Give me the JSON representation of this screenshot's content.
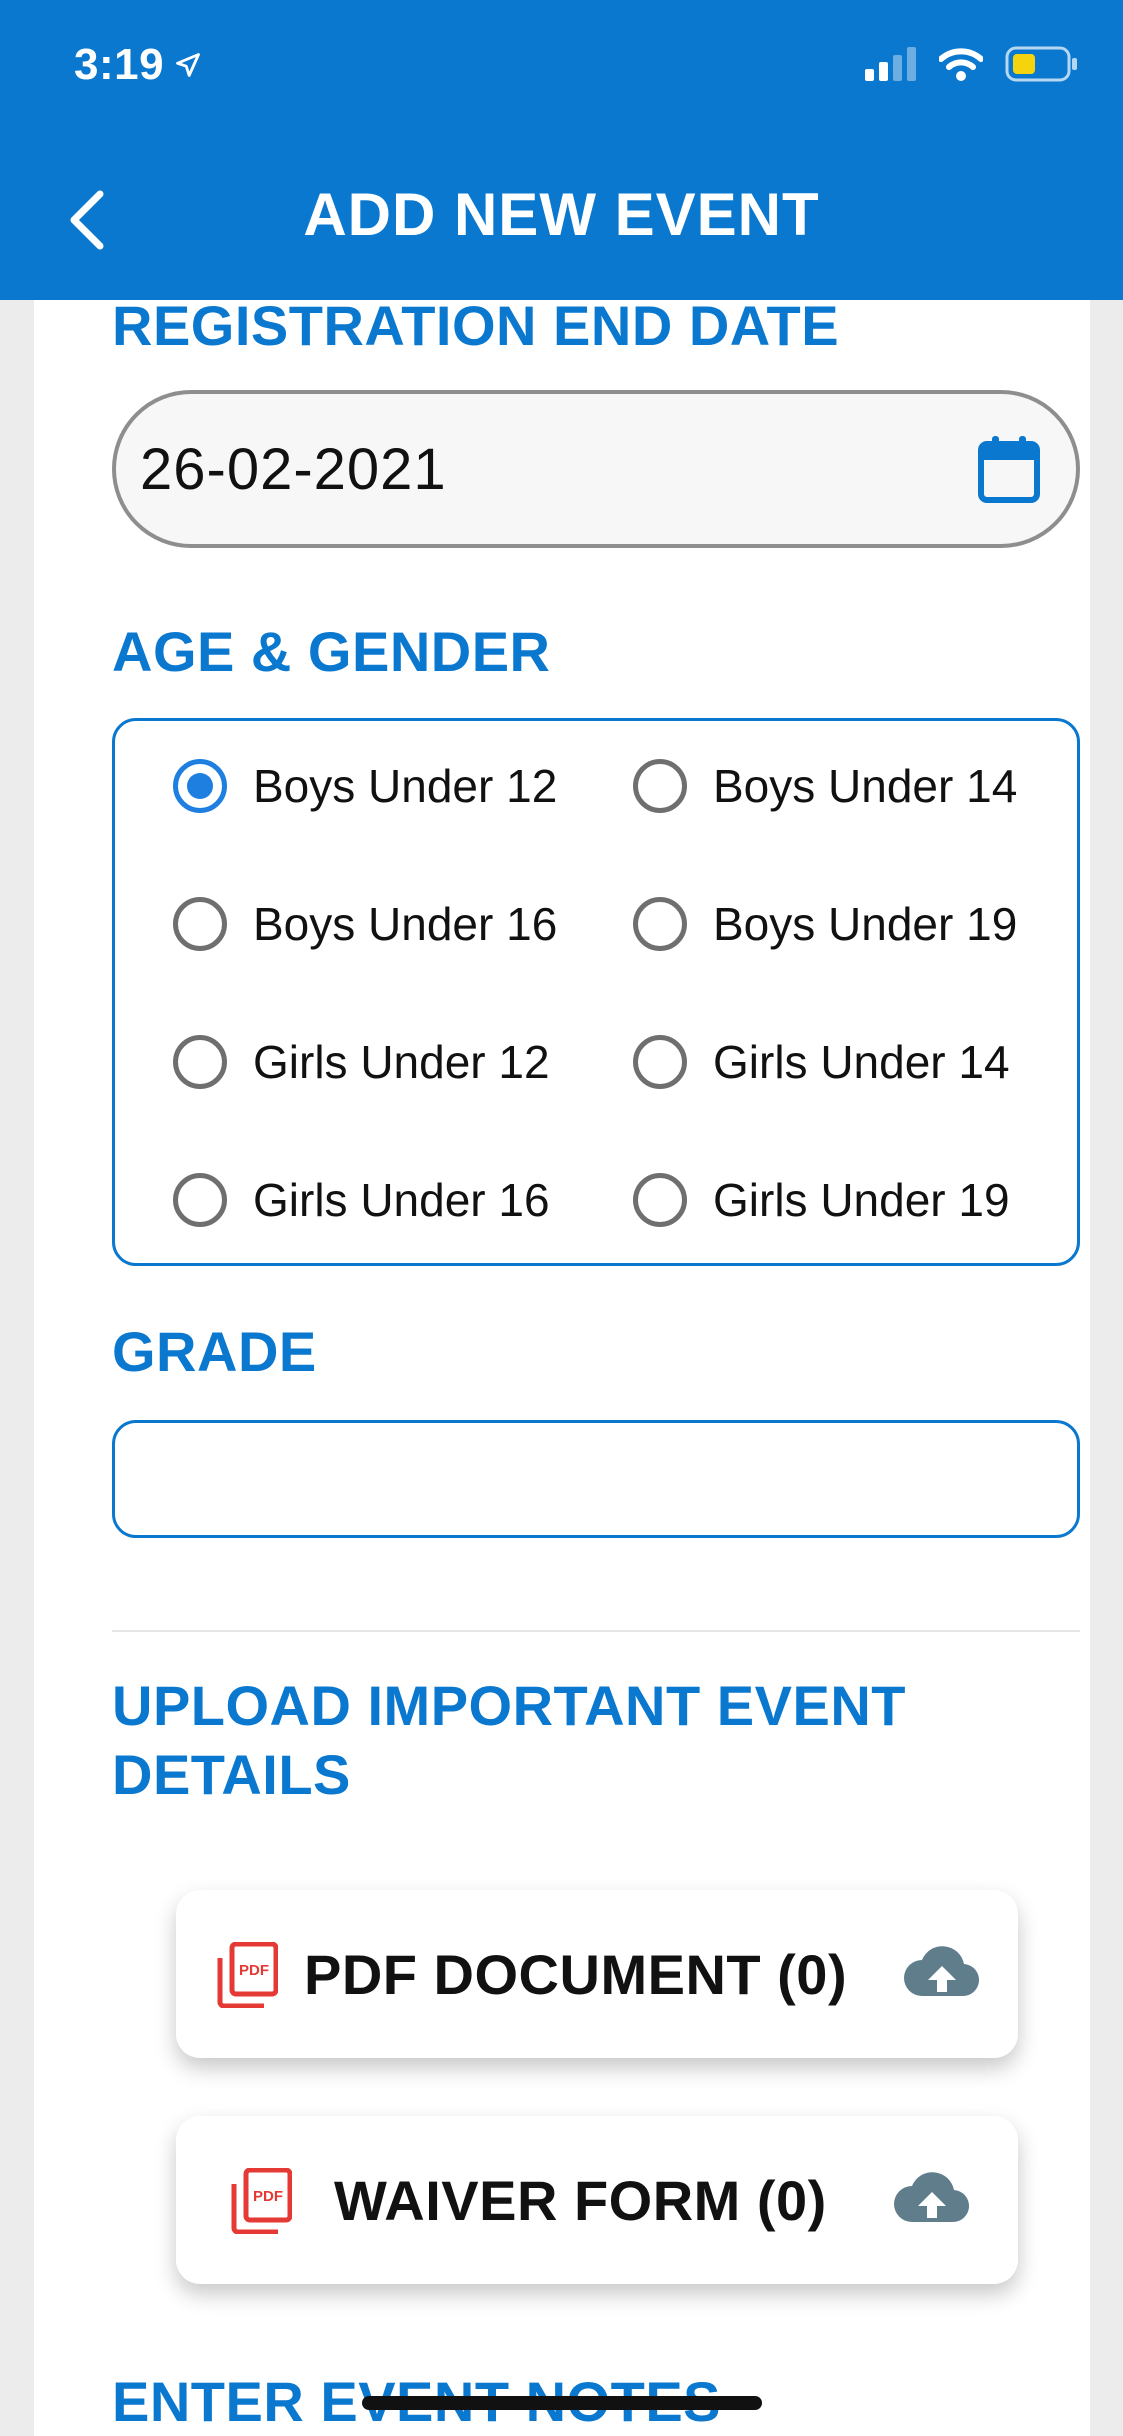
{
  "status_bar": {
    "time": "3:19"
  },
  "header": {
    "title": "ADD NEW EVENT"
  },
  "registration_end_date": {
    "label": "REGISTRATION END DATE",
    "value": "26-02-2021"
  },
  "age_gender": {
    "label": "AGE & GENDER",
    "selected": "Boys Under 12",
    "options": [
      "Boys Under 12",
      "Boys Under 14",
      "Boys Under 16",
      "Boys Under 19",
      "Girls Under 12",
      "Girls Under 14",
      "Girls Under 16",
      "Girls Under 19"
    ]
  },
  "grade": {
    "label": "GRADE",
    "value": ""
  },
  "upload": {
    "label_line1": "UPLOAD IMPORTANT EVENT",
    "label_line2": "DETAILS",
    "pdf_document": "PDF DOCUMENT (0)",
    "waiver_form": "WAIVER FORM (0)"
  },
  "notes": {
    "label": "ENTER EVENT NOTES"
  },
  "colors": {
    "primary": "#0a78cf",
    "radio_checked": "#1e7fe0",
    "pdf_red": "#e53935",
    "cloud_gray": "#607d8b"
  },
  "icons": [
    "location-arrow-icon",
    "signal-icon",
    "wifi-icon",
    "battery-icon",
    "back-chevron-icon",
    "calendar-icon",
    "pdf-icon",
    "cloud-upload-icon"
  ]
}
